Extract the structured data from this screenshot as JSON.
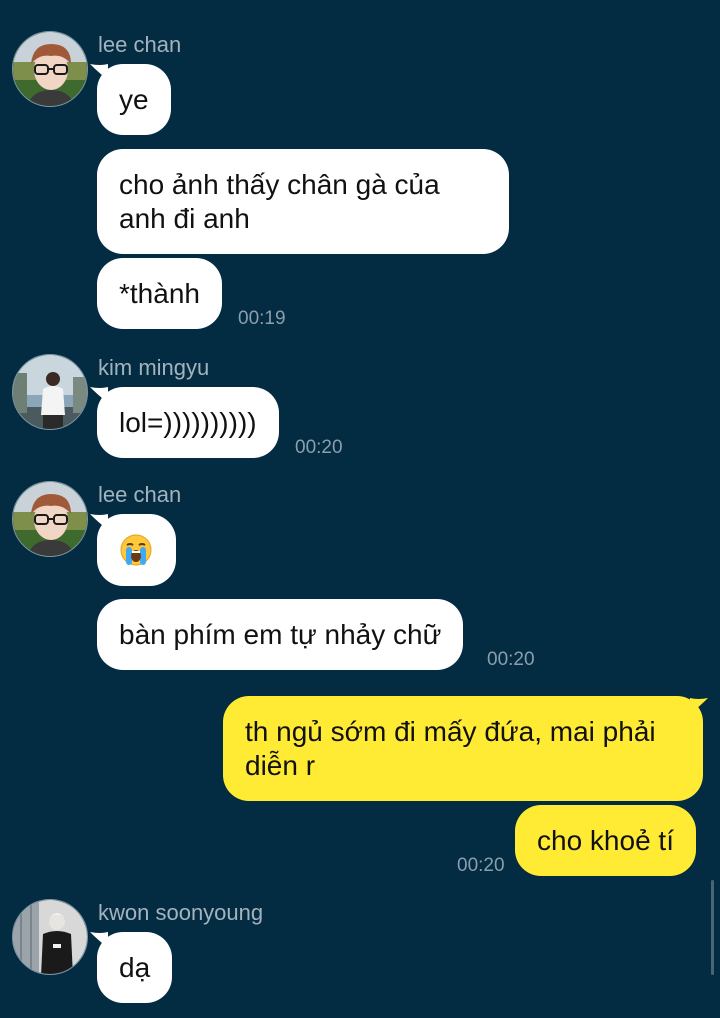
{
  "colors": {
    "background": "#032c43",
    "incoming_bubble": "#ffffff",
    "outgoing_bubble": "#ffeb33",
    "sender_name": "#a3b3bd",
    "timestamp": "#8a9eab"
  },
  "groups": [
    {
      "sender": "lee chan",
      "messages": [
        {
          "text": "ye"
        },
        {
          "text": "cho ảnh thấy chân gà của anh đi anh"
        },
        {
          "text": "*thành",
          "time": "00:19"
        }
      ]
    },
    {
      "sender": "kim mingyu",
      "messages": [
        {
          "text": "lol=))))))))))",
          "time": "00:20"
        }
      ]
    },
    {
      "sender": "lee chan",
      "messages": [
        {
          "emoji": "loudly-crying-face"
        },
        {
          "text": "bàn phím em tự nhảy chữ",
          "time": "00:20"
        }
      ]
    },
    {
      "sender": "me",
      "messages": [
        {
          "text": "th ngủ sớm đi mấy đứa, mai phải diễn r"
        },
        {
          "text": "cho khoẻ tí",
          "time": "00:20"
        }
      ]
    },
    {
      "sender": "kwon soonyoung",
      "messages": [
        {
          "text": "dạ"
        }
      ]
    }
  ]
}
